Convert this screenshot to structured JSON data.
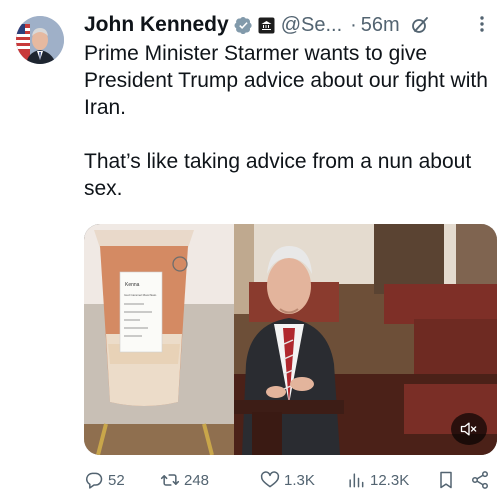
{
  "author": {
    "name": "John Kennedy",
    "handle": "@Se...",
    "separator": "·",
    "time": "56m"
  },
  "tweet": {
    "text": "Prime Minister Starmer wants to give President Trump advice about our fight with Iran.\n\nThat’s like taking advice from a nun about sex."
  },
  "media": {
    "type": "video",
    "cup_label_title": "Kenna",
    "cup_label_line": "Iced Caramel Macchiato"
  },
  "actions": {
    "replies": "52",
    "reposts": "248",
    "likes": "1.3K",
    "views": "12.3K"
  },
  "colors": {
    "text": "#0f1419",
    "secondary": "#536471",
    "verified": "#829aab"
  },
  "icons": [
    "verified-badge-icon",
    "government-badge-icon",
    "grok-icon",
    "more-icon",
    "reply-icon",
    "repost-icon",
    "like-icon",
    "views-icon",
    "bookmark-icon",
    "share-icon",
    "mute-icon"
  ]
}
